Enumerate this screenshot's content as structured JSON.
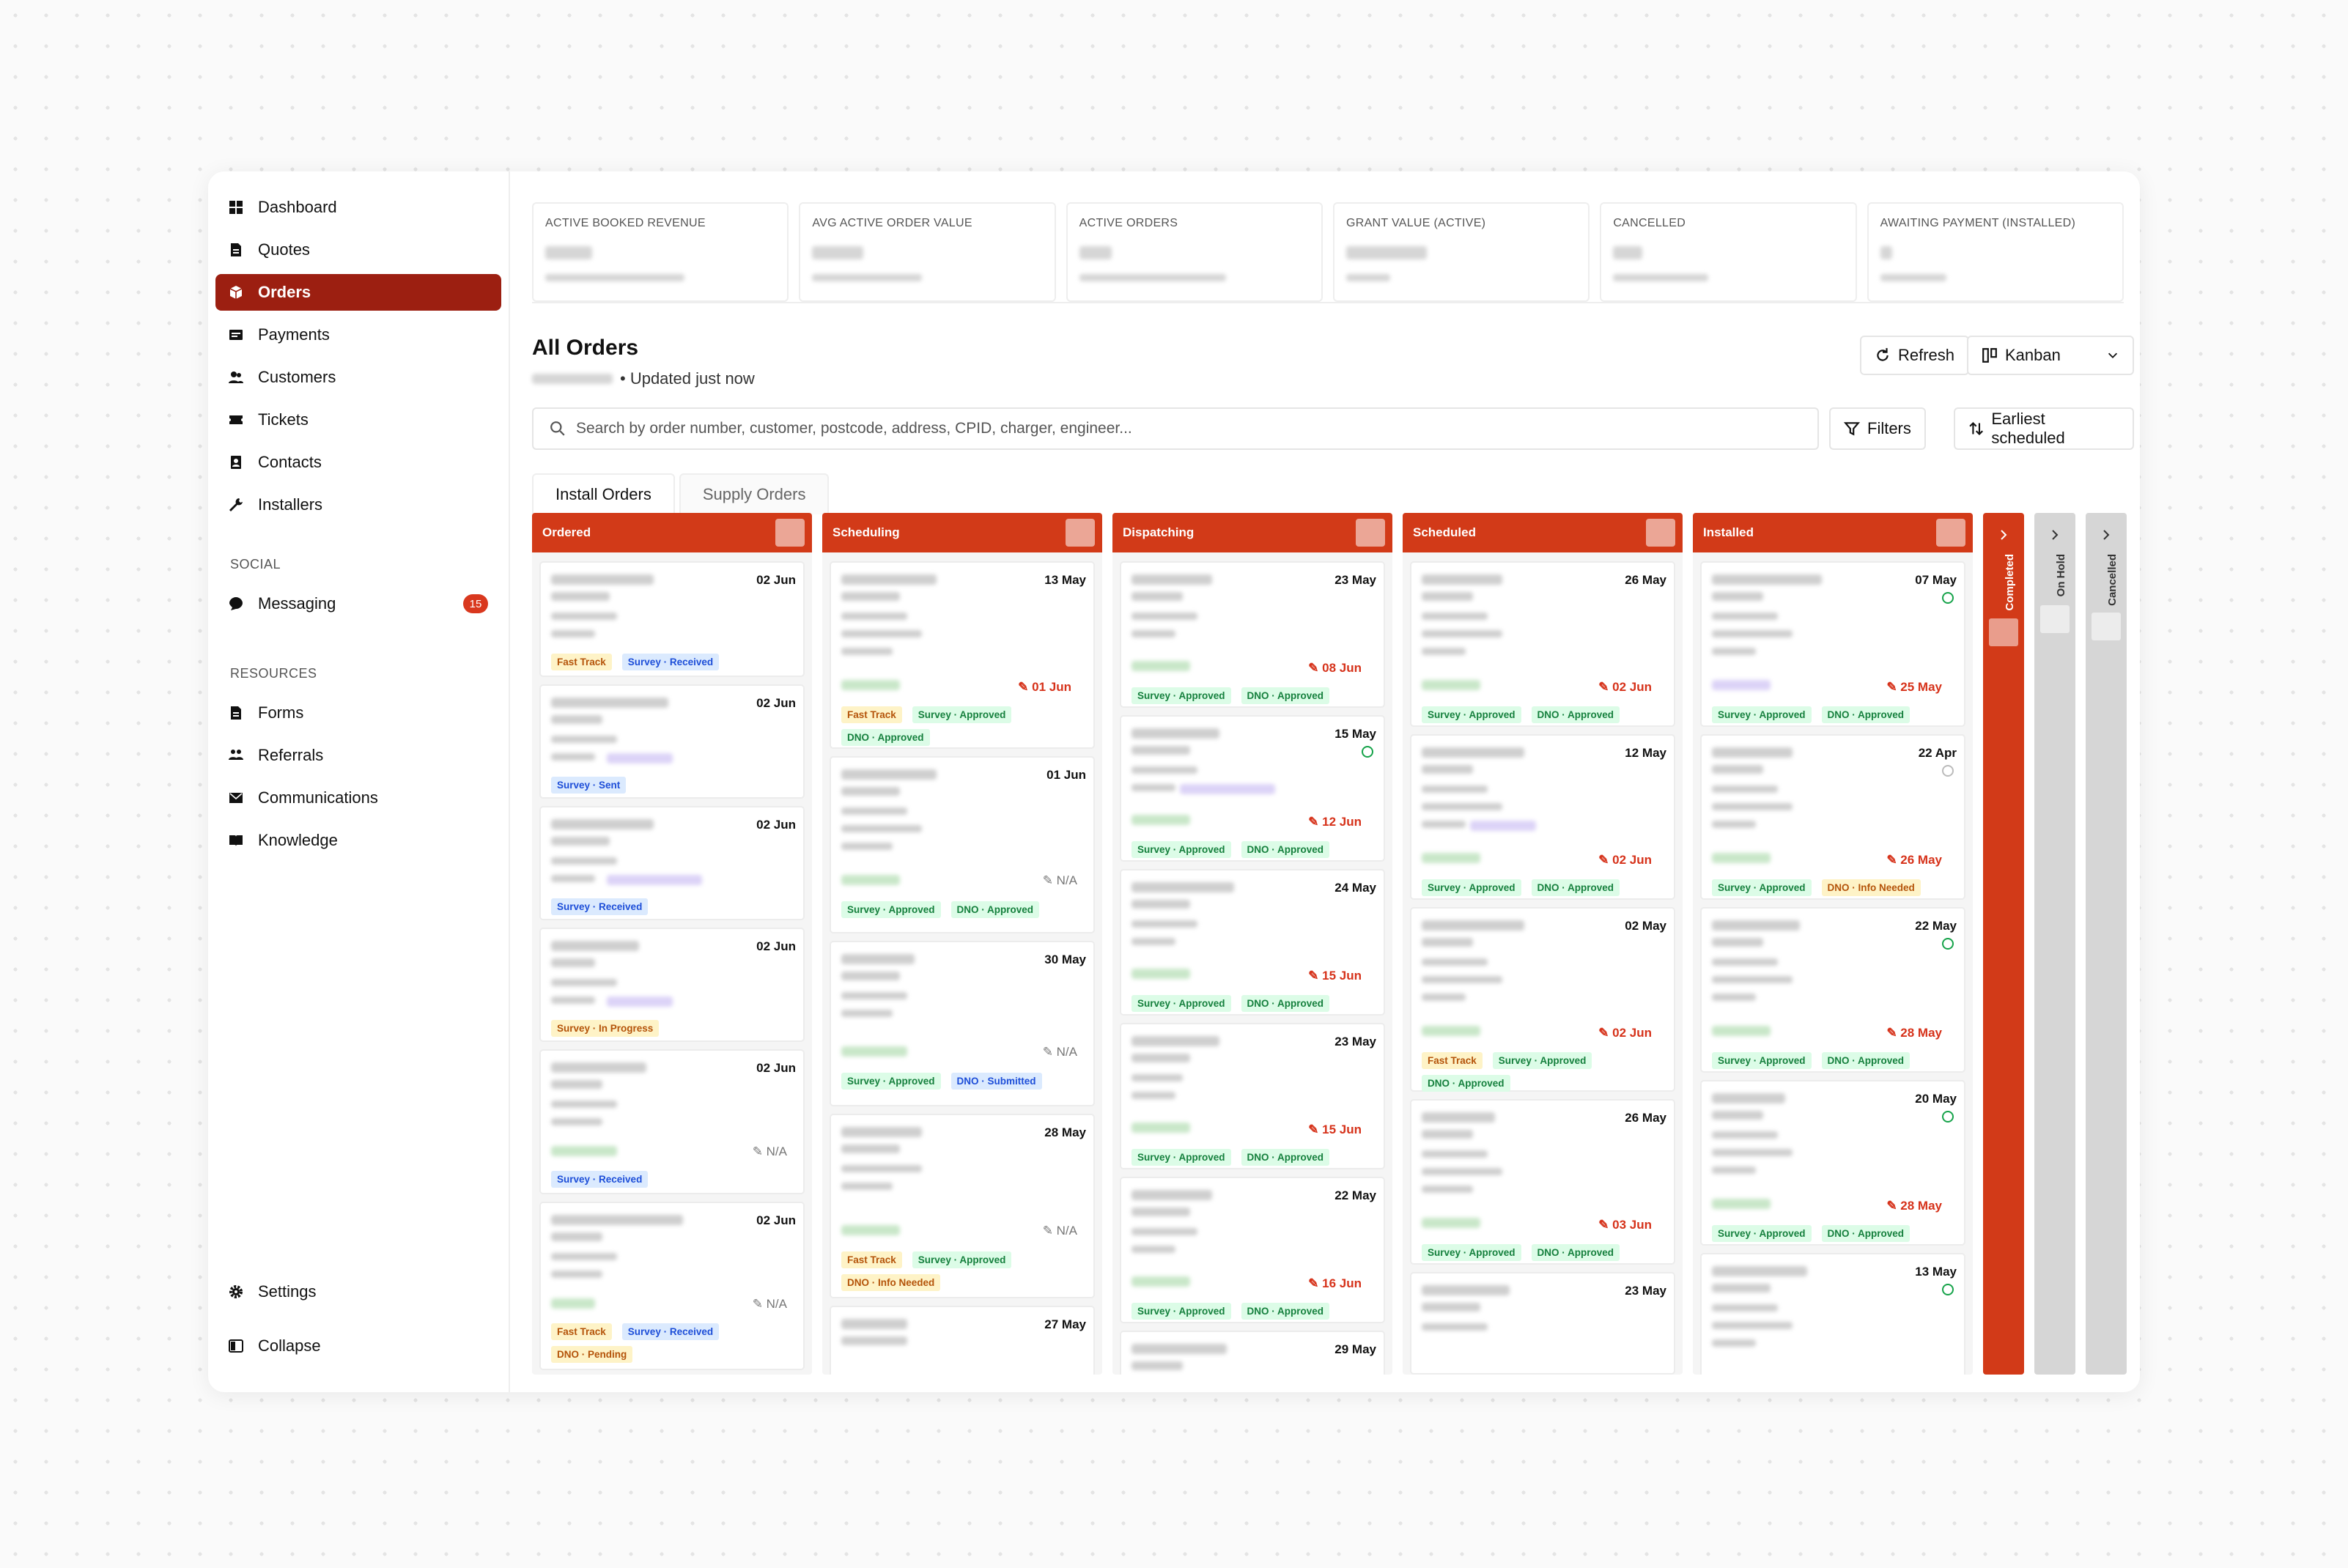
{
  "sidebar": {
    "items": [
      {
        "label": "Dashboard",
        "icon": "dashboard-icon"
      },
      {
        "label": "Quotes",
        "icon": "document-icon"
      },
      {
        "label": "Orders",
        "icon": "box-icon"
      },
      {
        "label": "Payments",
        "icon": "payments-icon"
      },
      {
        "label": "Customers",
        "icon": "users-icon"
      },
      {
        "label": "Tickets",
        "icon": "ticket-icon"
      },
      {
        "label": "Contacts",
        "icon": "contacts-icon"
      },
      {
        "label": "Installers",
        "icon": "wrench-icon"
      }
    ],
    "social_heading": "SOCIAL",
    "messaging": {
      "label": "Messaging",
      "badge": "15"
    },
    "resources_heading": "RESOURCES",
    "resources": [
      {
        "label": "Forms",
        "icon": "form-icon"
      },
      {
        "label": "Referrals",
        "icon": "referral-icon"
      },
      {
        "label": "Communications",
        "icon": "mail-icon"
      },
      {
        "label": "Knowledge",
        "icon": "book-icon"
      }
    ],
    "settings_label": "Settings",
    "collapse_label": "Collapse"
  },
  "stats": [
    "ACTIVE BOOKED REVENUE",
    "AVG ACTIVE ORDER VALUE",
    "ACTIVE ORDERS",
    "GRANT VALUE (ACTIVE)",
    "CANCELLED",
    "AWAITING PAYMENT (INSTALLED)"
  ],
  "header": {
    "title": "All Orders",
    "updated": "• Updated just now",
    "refresh_label": "Refresh",
    "view_label": "Kanban",
    "search_placeholder": "Search by order number, customer, postcode, address, CPID, charger, engineer...",
    "filters_label": "Filters",
    "sort_label": "Earliest scheduled"
  },
  "tabs": [
    "Install Orders",
    "Supply Orders"
  ],
  "columns": {
    "ordered": {
      "title": "Ordered",
      "cards": [
        {
          "date": "02 Jun",
          "tags": [
            "Fast Track",
            "Survey · Received"
          ]
        },
        {
          "date": "02 Jun",
          "tags": [
            "Survey · Sent"
          ]
        },
        {
          "date": "02 Jun",
          "tags": [
            "Survey · Received"
          ]
        },
        {
          "date": "02 Jun",
          "tags": [
            "Survey · In Progress"
          ]
        },
        {
          "date": "02 Jun",
          "na": "N/A",
          "tags": [
            "Survey · Received"
          ]
        },
        {
          "date": "02 Jun",
          "na": "N/A",
          "tags": [
            "Fast Track",
            "Survey · Received",
            "DNO · Pending"
          ]
        }
      ]
    },
    "scheduling": {
      "title": "Scheduling",
      "cards": [
        {
          "date": "13 May",
          "eta": "01 Jun",
          "tags": [
            "Fast Track",
            "Survey · Approved",
            "DNO · Approved"
          ]
        },
        {
          "date": "01 Jun",
          "na": "N/A",
          "tags": [
            "Survey · Approved",
            "DNO · Approved"
          ]
        },
        {
          "date": "30 May",
          "na": "N/A",
          "tags": [
            "Survey · Approved",
            "DNO · Submitted"
          ]
        },
        {
          "date": "28 May",
          "na": "N/A",
          "tags": [
            "Fast Track",
            "Survey · Approved",
            "DNO · Info Needed"
          ]
        },
        {
          "date": "27 May"
        }
      ]
    },
    "dispatching": {
      "title": "Dispatching",
      "cards": [
        {
          "date": "23 May",
          "eta": "08 Jun",
          "tags": [
            "Survey · Approved",
            "DNO · Approved"
          ]
        },
        {
          "date": "15 May",
          "eta": "12 Jun",
          "tags": [
            "Survey · Approved",
            "DNO · Approved"
          ]
        },
        {
          "date": "24 May",
          "eta": "15 Jun",
          "tags": [
            "Survey · Approved",
            "DNO · Approved"
          ]
        },
        {
          "date": "23 May",
          "eta": "15 Jun",
          "tags": [
            "Survey · Approved",
            "DNO · Approved"
          ]
        },
        {
          "date": "22 May",
          "eta": "16 Jun",
          "tags": [
            "Survey · Approved",
            "DNO · Approved"
          ]
        },
        {
          "date": "29 May"
        }
      ]
    },
    "scheduled": {
      "title": "Scheduled",
      "cards": [
        {
          "date": "26 May",
          "eta": "02 Jun",
          "tags": [
            "Survey · Approved",
            "DNO · Approved"
          ]
        },
        {
          "date": "12 May",
          "eta": "02 Jun",
          "tags": [
            "Survey · Approved",
            "DNO · Approved"
          ]
        },
        {
          "date": "02 May",
          "eta": "02 Jun",
          "tags": [
            "Fast Track",
            "Survey · Approved",
            "DNO · Approved"
          ]
        },
        {
          "date": "26 May",
          "eta": "03 Jun",
          "tags": [
            "Survey · Approved",
            "DNO · Approved"
          ]
        },
        {
          "date": "23 May"
        }
      ]
    },
    "installed": {
      "title": "Installed",
      "cards": [
        {
          "date": "07 May",
          "eta": "25 May",
          "tags": [
            "Survey · Approved",
            "DNO · Approved"
          ]
        },
        {
          "date": "22 Apr",
          "eta": "26 May",
          "tags": [
            "Survey · Approved",
            "DNO · Info Needed"
          ]
        },
        {
          "date": "22 May",
          "eta": "28 May",
          "tags": [
            "Survey · Approved",
            "DNO · Approved"
          ]
        },
        {
          "date": "20 May",
          "eta": "28 May",
          "tags": [
            "Survey · Approved",
            "DNO · Approved"
          ]
        },
        {
          "date": "13 May"
        }
      ]
    }
  },
  "collapsed_columns": [
    "Completed",
    "On Hold",
    "Cancelled"
  ],
  "colors": {
    "brand_dark": "#9c1f11",
    "column_header": "#d23a18",
    "tag_green": "#15803d",
    "tag_blue": "#1d4ed8",
    "tag_yellow": "#b45309"
  }
}
